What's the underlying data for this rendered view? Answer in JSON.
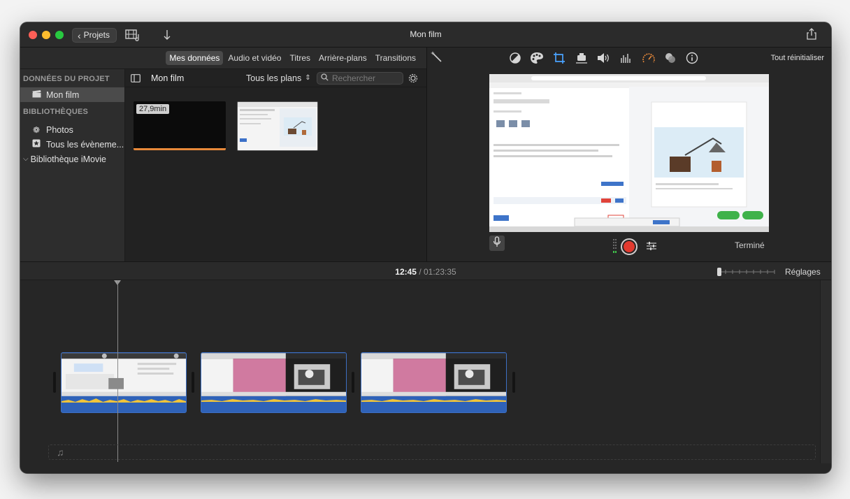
{
  "window": {
    "title": "Mon film"
  },
  "toolbar": {
    "projects_label": "Projets"
  },
  "browser_tabs": [
    "Mes données",
    "Audio et vidéo",
    "Titres",
    "Arrière-plans",
    "Transitions"
  ],
  "sidebar": {
    "project_header": "DONNÉES DU PROJET",
    "project_item": "Mon film",
    "libraries_header": "BIBLIOTHÈQUES",
    "items": [
      "Photos",
      "Tous les évèneme..."
    ],
    "library": "Bibliothèque iMovie"
  },
  "browser": {
    "title": "Mon film",
    "filter": "Tous les plans",
    "search_placeholder": "Rechercher",
    "clip_duration": "27,9min"
  },
  "viewer": {
    "reset_all": "Tout réinitialiser",
    "done": "Terminé"
  },
  "timeline": {
    "current_time": "12:45",
    "separator": "/",
    "total_time": "01:23:35",
    "settings": "Réglages"
  },
  "colors": {
    "accent_orange": "#e8893a",
    "clip_blue": "#2f62b8",
    "record_red": "#e23a2f"
  }
}
